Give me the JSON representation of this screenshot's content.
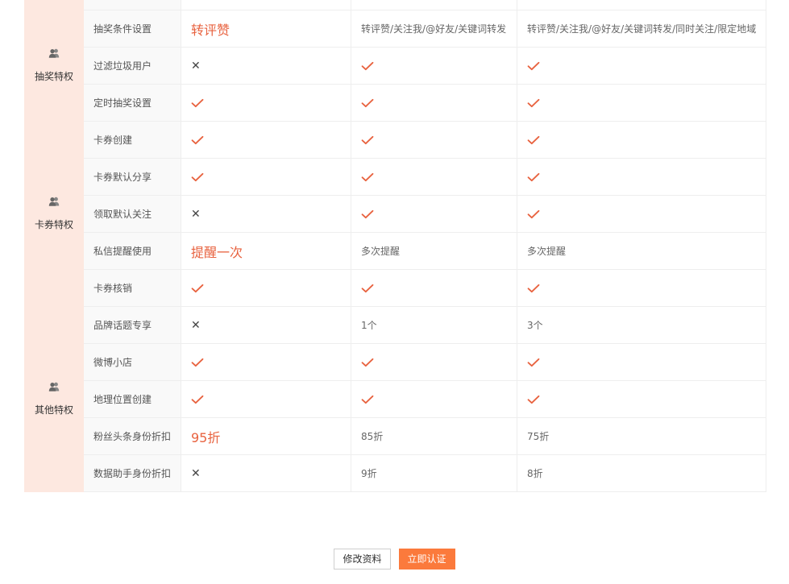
{
  "colors": {
    "accent": "#e8623f",
    "category_bg": "#fde8e0",
    "primary_button": "#fb7a3c"
  },
  "icons": {
    "category": "users-icon",
    "check": "check-icon",
    "cross": "cross-icon"
  },
  "groups": [
    {
      "name": "抽奖特权",
      "rows": [
        {
          "feature": "抽奖条件设置",
          "values": [
            {
              "t": "hl",
              "v": "转评赞"
            },
            {
              "t": "text",
              "v": "转评赞/关注我/@好友/关键词转发"
            },
            {
              "t": "text",
              "v": "转评赞/关注我/@好友/关键词转发/同时关注/限定地域"
            }
          ]
        },
        {
          "feature": "过滤垃圾用户",
          "values": [
            {
              "t": "cross"
            },
            {
              "t": "check"
            },
            {
              "t": "check"
            }
          ]
        },
        {
          "feature": "定时抽奖设置",
          "values": [
            {
              "t": "check"
            },
            {
              "t": "check"
            },
            {
              "t": "check"
            }
          ]
        }
      ]
    },
    {
      "name": "卡券特权",
      "rows": [
        {
          "feature": "卡券创建",
          "values": [
            {
              "t": "check"
            },
            {
              "t": "check"
            },
            {
              "t": "check"
            }
          ]
        },
        {
          "feature": "卡券默认分享",
          "values": [
            {
              "t": "check"
            },
            {
              "t": "check"
            },
            {
              "t": "check"
            }
          ]
        },
        {
          "feature": "领取默认关注",
          "values": [
            {
              "t": "cross"
            },
            {
              "t": "check"
            },
            {
              "t": "check"
            }
          ]
        },
        {
          "feature": "私信提醒使用",
          "values": [
            {
              "t": "hl",
              "v": "提醒一次"
            },
            {
              "t": "text",
              "v": "多次提醒"
            },
            {
              "t": "text",
              "v": "多次提醒"
            }
          ]
        },
        {
          "feature": "卡券核销",
          "values": [
            {
              "t": "check"
            },
            {
              "t": "check"
            },
            {
              "t": "check"
            }
          ]
        }
      ]
    },
    {
      "name": "其他特权",
      "rows": [
        {
          "feature": "品牌话题专享",
          "values": [
            {
              "t": "cross"
            },
            {
              "t": "text",
              "v": "1个"
            },
            {
              "t": "text",
              "v": "3个"
            }
          ]
        },
        {
          "feature": "微博小店",
          "values": [
            {
              "t": "check"
            },
            {
              "t": "check"
            },
            {
              "t": "check"
            }
          ]
        },
        {
          "feature": "地理位置创建",
          "values": [
            {
              "t": "check"
            },
            {
              "t": "check"
            },
            {
              "t": "check"
            }
          ]
        },
        {
          "feature": "粉丝头条身份折扣",
          "values": [
            {
              "t": "hl",
              "v": "95折"
            },
            {
              "t": "text",
              "v": "85折"
            },
            {
              "t": "text",
              "v": "75折"
            }
          ]
        },
        {
          "feature": "数据助手身份折扣",
          "values": [
            {
              "t": "cross"
            },
            {
              "t": "text",
              "v": "9折"
            },
            {
              "t": "text",
              "v": "8折"
            }
          ]
        }
      ]
    }
  ],
  "buttons": {
    "edit_profile": "修改资料",
    "certify_now": "立即认证"
  }
}
